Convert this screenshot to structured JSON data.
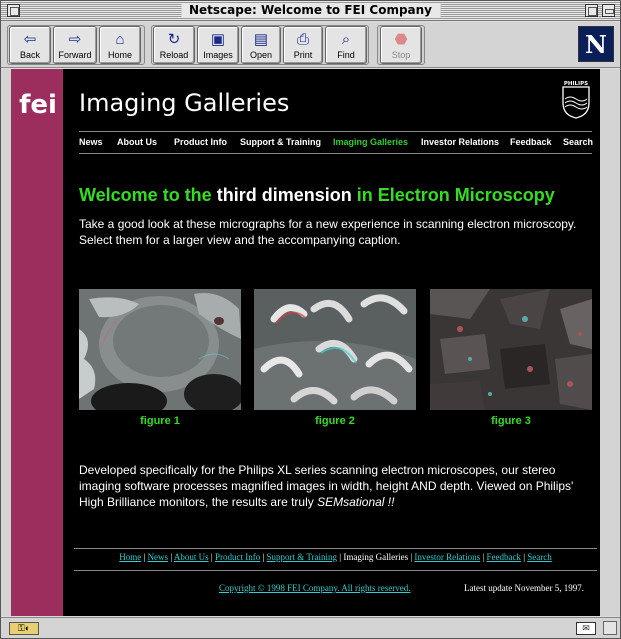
{
  "window": {
    "title": "Netscape: Welcome to FEI Company"
  },
  "toolbar": {
    "back": "Back",
    "forward": "Forward",
    "home": "Home",
    "reload": "Reload",
    "images": "Images",
    "open": "Open",
    "print": "Print",
    "find": "Find",
    "stop": "Stop",
    "icons": {
      "back": "left-arrow-icon",
      "forward": "right-arrow-icon",
      "home": "house-icon",
      "reload": "reload-icon",
      "images": "images-icon",
      "open": "open-folder-icon",
      "print": "printer-icon",
      "find": "binoculars-icon",
      "stop": "stop-sign-icon"
    },
    "logo_letter": "N"
  },
  "page": {
    "logo_text": "fei",
    "title": "Imaging Galleries",
    "philips_label": "PHILIPS",
    "nav": [
      {
        "label": "News",
        "active": false
      },
      {
        "label": "About Us",
        "active": false
      },
      {
        "label": "Product Info",
        "active": false
      },
      {
        "label": "Support & Training",
        "active": false
      },
      {
        "label": "Imaging Galleries",
        "active": true
      },
      {
        "label": "Investor Relations",
        "active": false
      },
      {
        "label": "Feedback",
        "active": false
      },
      {
        "label": "Search",
        "active": false
      }
    ],
    "headline": {
      "part1": "Welcome to the ",
      "part2": "third dimension",
      "part3": " in Electron Microscopy"
    },
    "intro": "Take a good look at these micrographs for a new experience in scanning electron microscopy. Select them for a larger view and the accompanying caption.",
    "figures": [
      {
        "caption": "figure 1"
      },
      {
        "caption": "figure 2"
      },
      {
        "caption": "figure 3"
      }
    ],
    "body_text": "Developed specifically for the Philips XL series scanning electron microscopes, our stereo imaging software processes magnified images in width, height AND depth. Viewed on Philips' High Brilliance monitors, the results are truly ",
    "body_emph": "SEMsational !!",
    "footer_nav": [
      {
        "label": "Home",
        "link": true
      },
      {
        "label": "News",
        "link": true
      },
      {
        "label": "About Us",
        "link": true
      },
      {
        "label": "Product Info",
        "link": true
      },
      {
        "label": "Support & Training",
        "link": true
      },
      {
        "label": "Imaging Galleries",
        "link": false
      },
      {
        "label": "Investor Relations",
        "link": true
      },
      {
        "label": "Feedback",
        "link": true
      },
      {
        "label": "Search",
        "link": true
      }
    ],
    "copyright": "Copyright © 1998 FEI Company.  All rights reserved.",
    "last_update": "Latest update November 5, 1997."
  },
  "status": {
    "text": "",
    "security_icon": "lock-key-icon",
    "mail_icon": "mail-envelope-icon"
  },
  "colors": {
    "accent_green": "#33dd22",
    "sidebar_magenta": "#9c2e5e",
    "link_cyan": "#33cccc",
    "background": "#000000"
  }
}
